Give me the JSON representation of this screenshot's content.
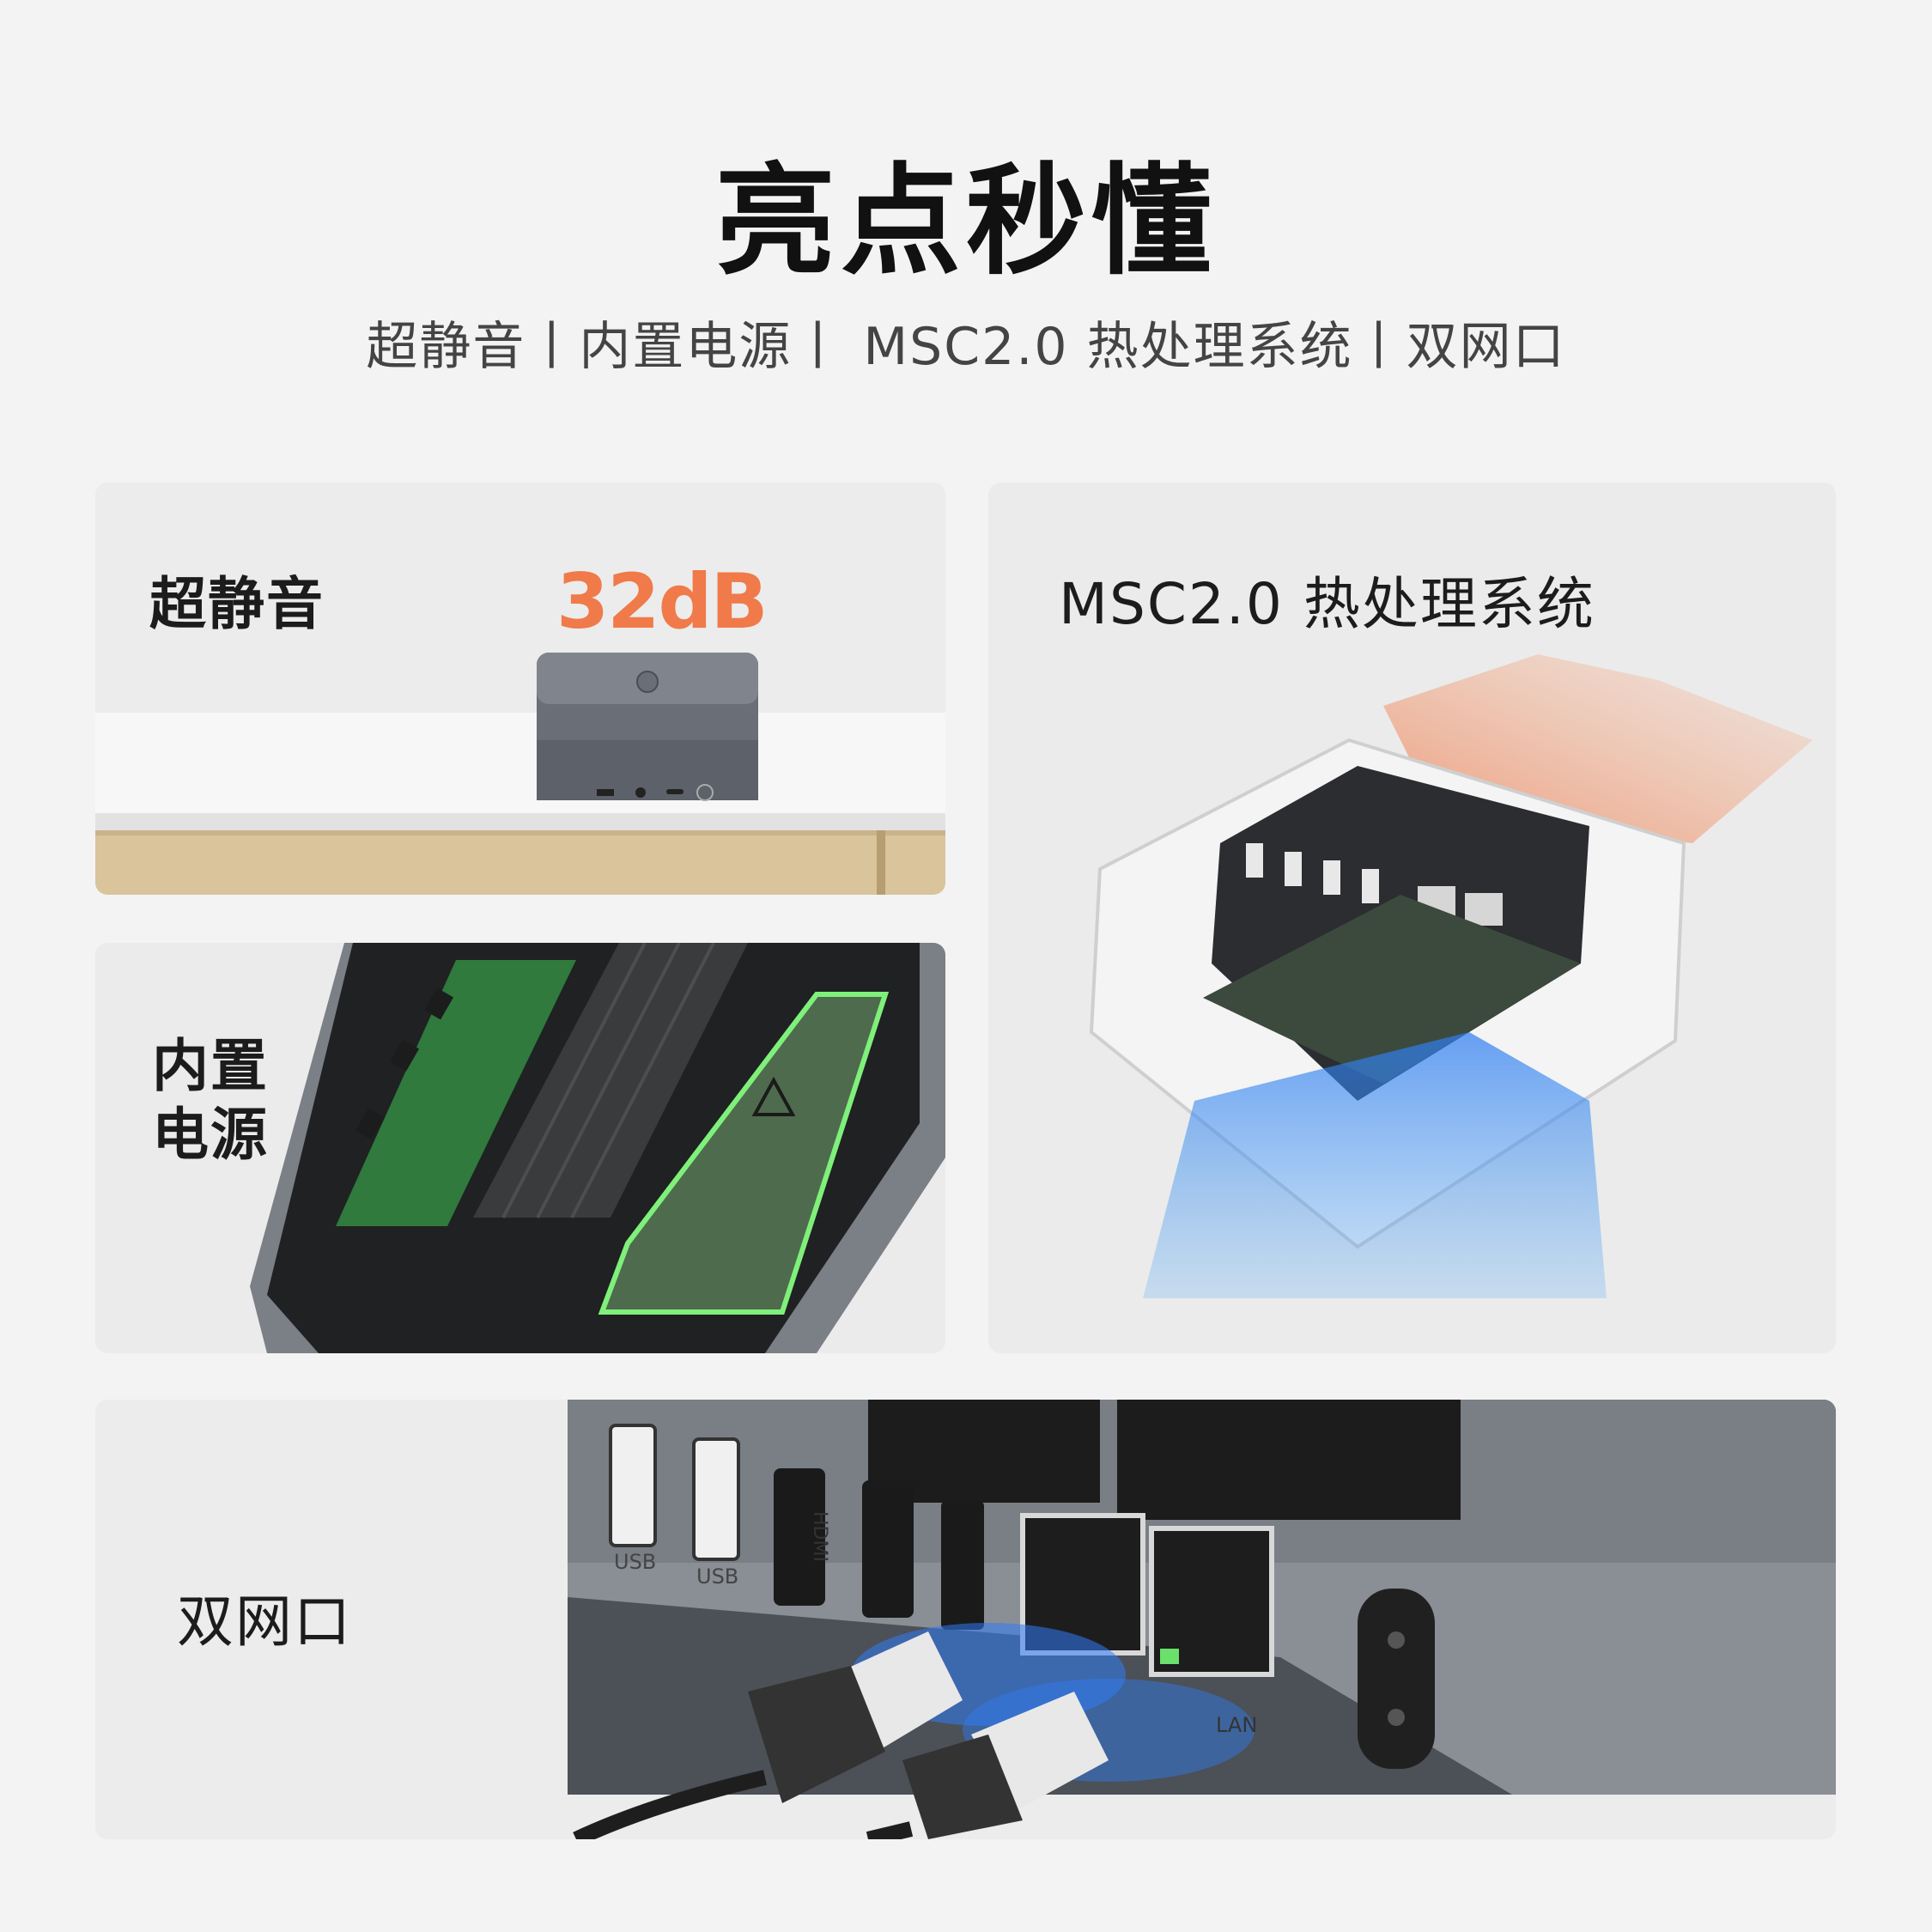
{
  "title": "亮点秒懂",
  "subtitle": "超静音丨内置电源丨 MSC2.0 热处理系统丨双网口",
  "cards": {
    "silent": {
      "label": "超静音",
      "badge": "32dB"
    },
    "power": {
      "label_line1": "内置",
      "label_line2": "电源"
    },
    "thermal": {
      "label": "MSC2.0 热处理系统"
    },
    "lan": {
      "label": "双网口",
      "port_usb1": "USB",
      "port_usb2": "USB",
      "port_hdmi": "HDMI",
      "port_lan": "LAN"
    }
  }
}
